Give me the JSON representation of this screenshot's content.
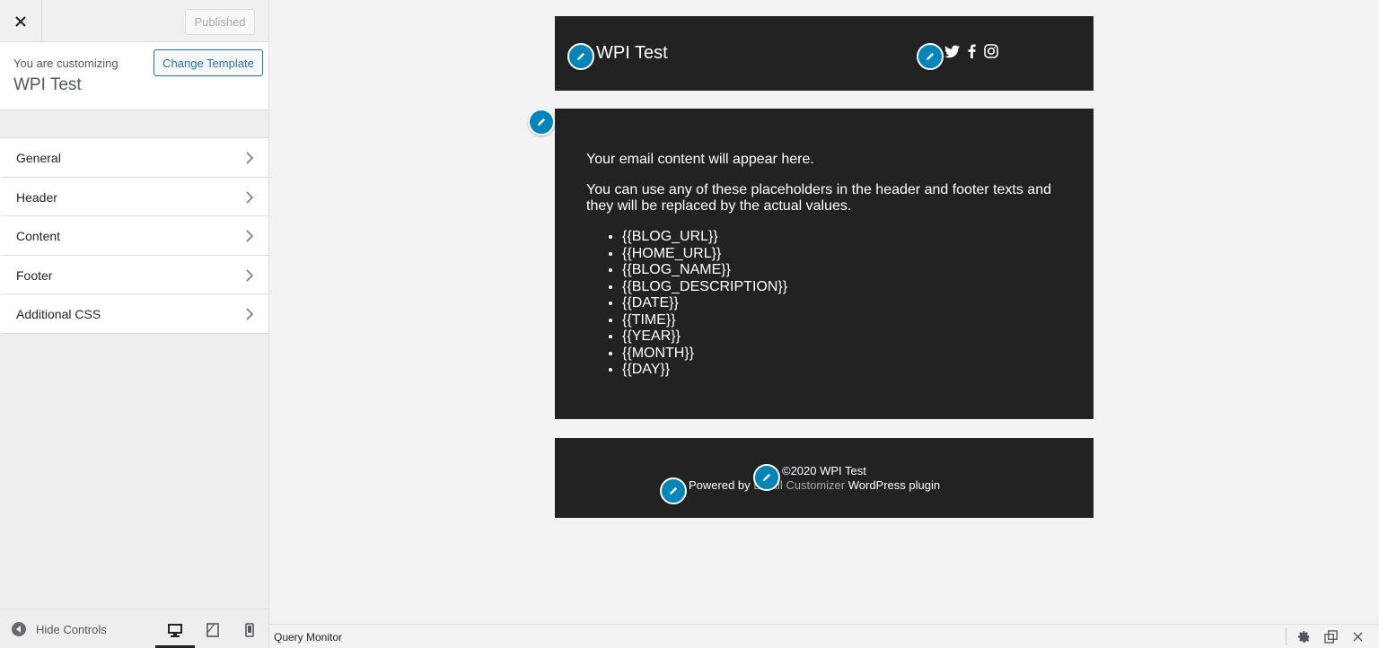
{
  "sidebar": {
    "published_label": "Published",
    "customizing_label": "You are customizing",
    "template_title": "WPI Test",
    "change_template_label": "Change Template",
    "menu": [
      {
        "label": "General"
      },
      {
        "label": "Header"
      },
      {
        "label": "Content"
      },
      {
        "label": "Footer"
      },
      {
        "label": "Additional CSS"
      }
    ],
    "hide_controls_label": "Hide Controls",
    "active_device": "desktop"
  },
  "preview": {
    "header": {
      "site_name": "WPI Test",
      "social_icons": [
        "twitter-icon",
        "facebook-icon",
        "instagram-icon"
      ]
    },
    "content": {
      "intro": "Your email content will appear here.",
      "description": "You can use any of these placeholders in the header and footer texts and they will be replaced by the actual values.",
      "placeholders": [
        "{{BLOG_URL}}",
        "{{HOME_URL}}",
        "{{BLOG_NAME}}",
        "{{BLOG_DESCRIPTION}}",
        "{{DATE}}",
        "{{TIME}}",
        "{{YEAR}}",
        "{{MONTH}}",
        "{{DAY}}"
      ]
    },
    "footer": {
      "copyright": "©2020 WPI Test",
      "powered_prefix": "Powered by ",
      "powered_link": "Email Customizer",
      "powered_suffix": " WordPress plugin"
    }
  },
  "query_monitor": {
    "title": "Query Monitor"
  },
  "colors": {
    "accent": "#2271b1",
    "edit_button": "#0085ba",
    "email_background": "#222222"
  }
}
